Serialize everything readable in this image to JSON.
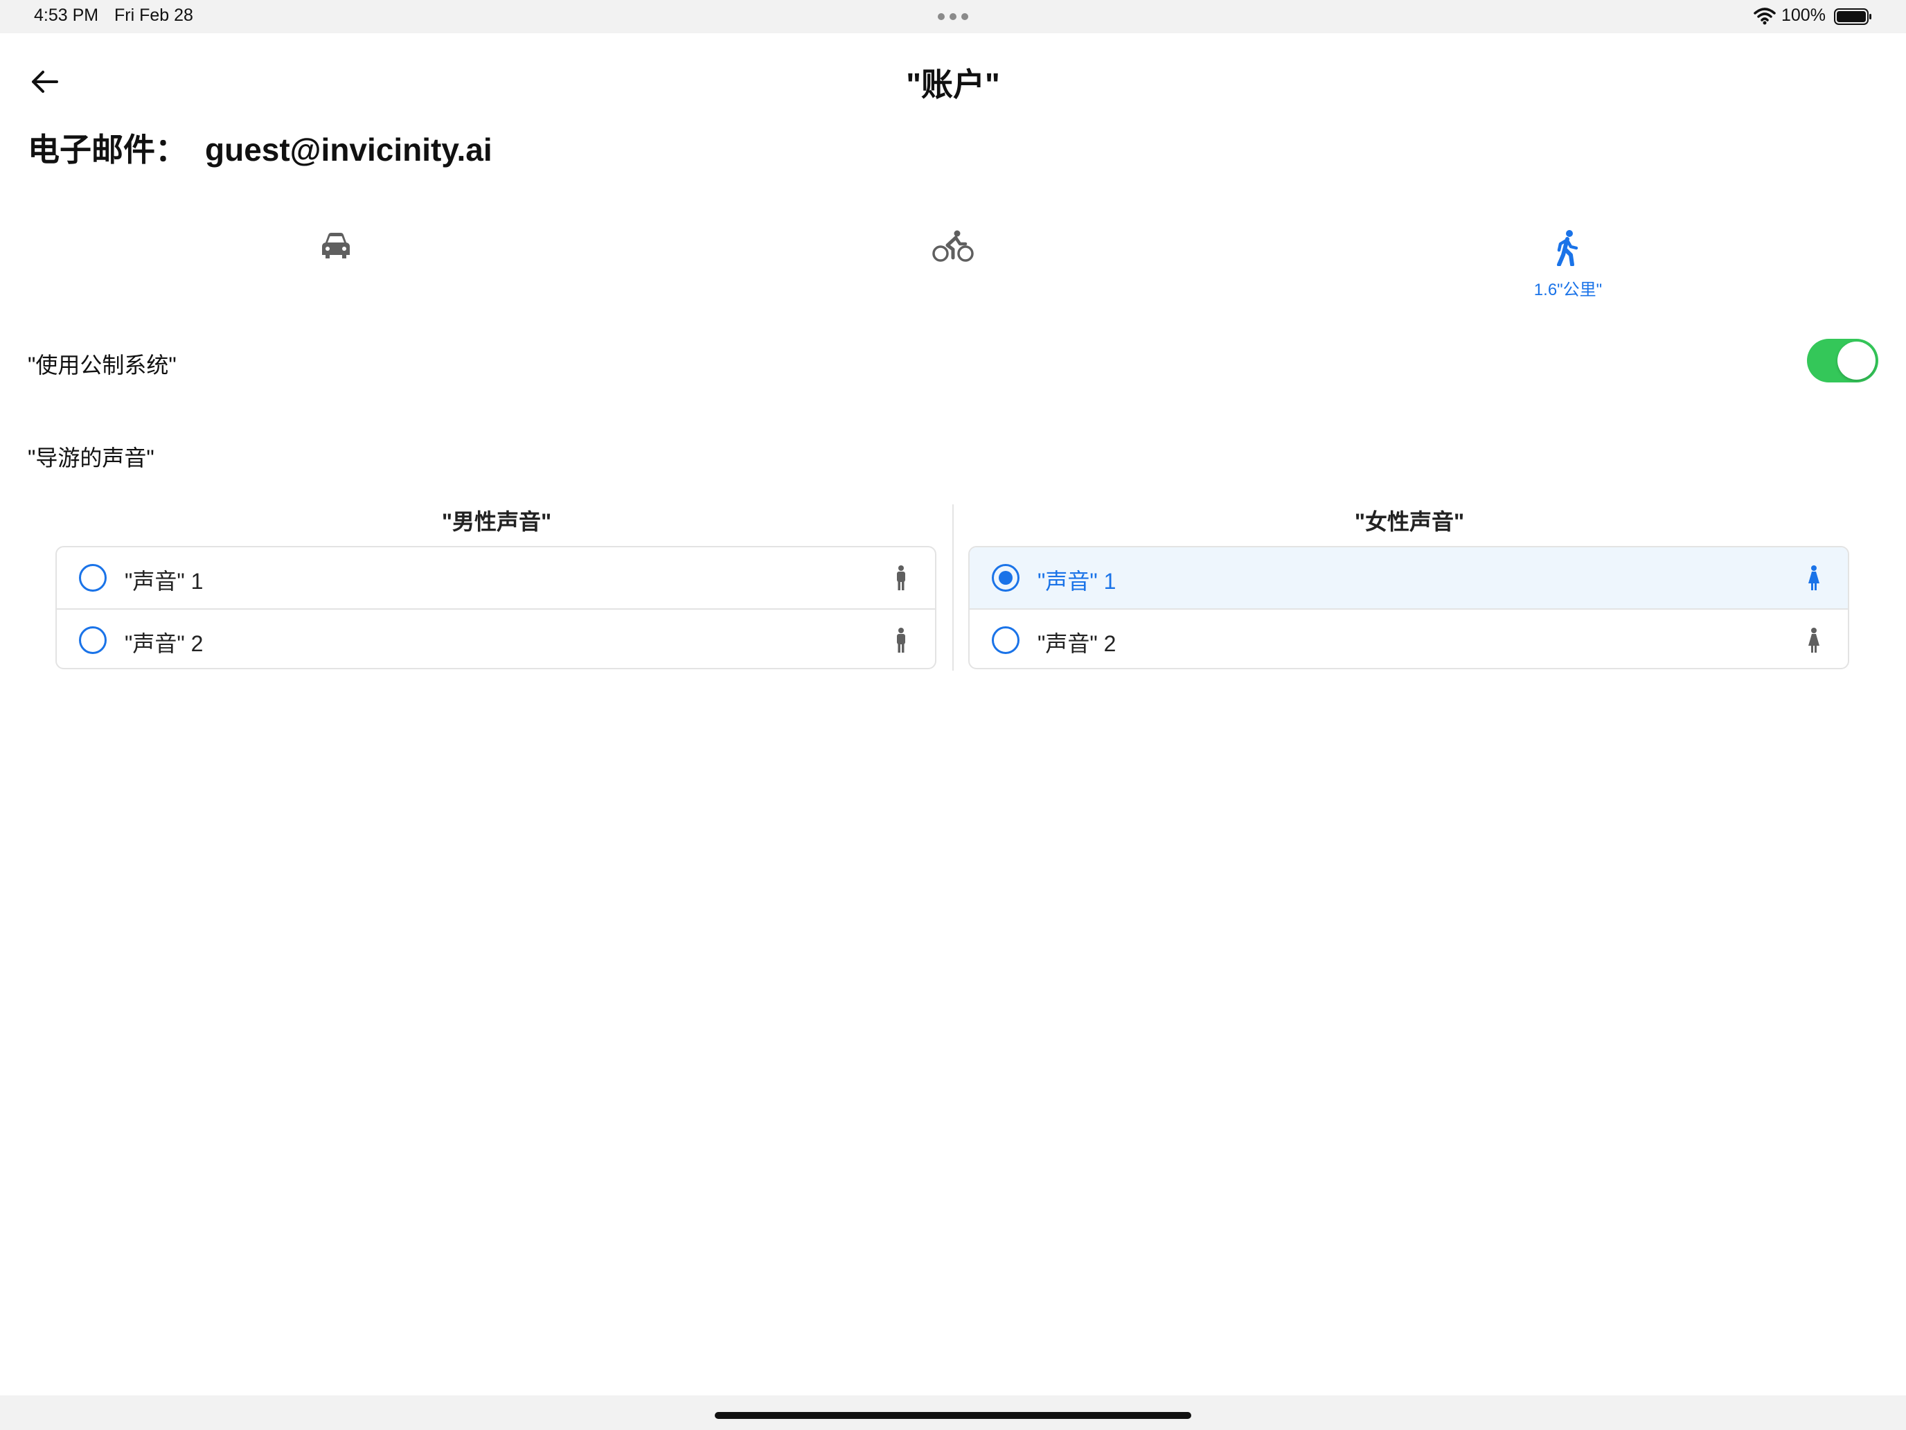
{
  "status_bar": {
    "time": "4:53 PM",
    "date": "Fri Feb 28",
    "battery_percent": "100%",
    "icons": [
      "multitask-dots-icon",
      "wifi-icon",
      "battery-icon"
    ]
  },
  "header": {
    "title": "\"账户\"",
    "back_icon": "back-arrow-icon"
  },
  "account": {
    "email_label": "电子邮件：",
    "email_value": "guest@invicinity.ai"
  },
  "transport_tabs": [
    {
      "icon": "car-icon",
      "label": "",
      "selected": false
    },
    {
      "icon": "bicycle-icon",
      "label": "",
      "selected": false
    },
    {
      "icon": "walk-icon",
      "label": "1.6\"公里\"",
      "selected": true
    }
  ],
  "settings": {
    "metric_label": "\"使用公制系统\"",
    "metric_enabled": true,
    "voice_section_label": "\"导游的声音\""
  },
  "voices": {
    "male": {
      "title": "\"男性声音\"",
      "options": [
        {
          "label": "\"声音\" 1",
          "selected": false,
          "icon": "male-person-icon"
        },
        {
          "label": "\"声音\" 2",
          "selected": false,
          "icon": "male-person-icon"
        }
      ]
    },
    "female": {
      "title": "\"女性声音\"",
      "options": [
        {
          "label": "\"声音\" 1",
          "selected": true,
          "icon": "female-person-icon"
        },
        {
          "label": "\"声音\" 2",
          "selected": false,
          "icon": "female-person-icon"
        }
      ]
    }
  },
  "colors": {
    "accent": "#1a73e8",
    "toggle_on": "#34c759",
    "selected_row": "#eef6fd",
    "icon_gray": "#5f5f5f"
  }
}
